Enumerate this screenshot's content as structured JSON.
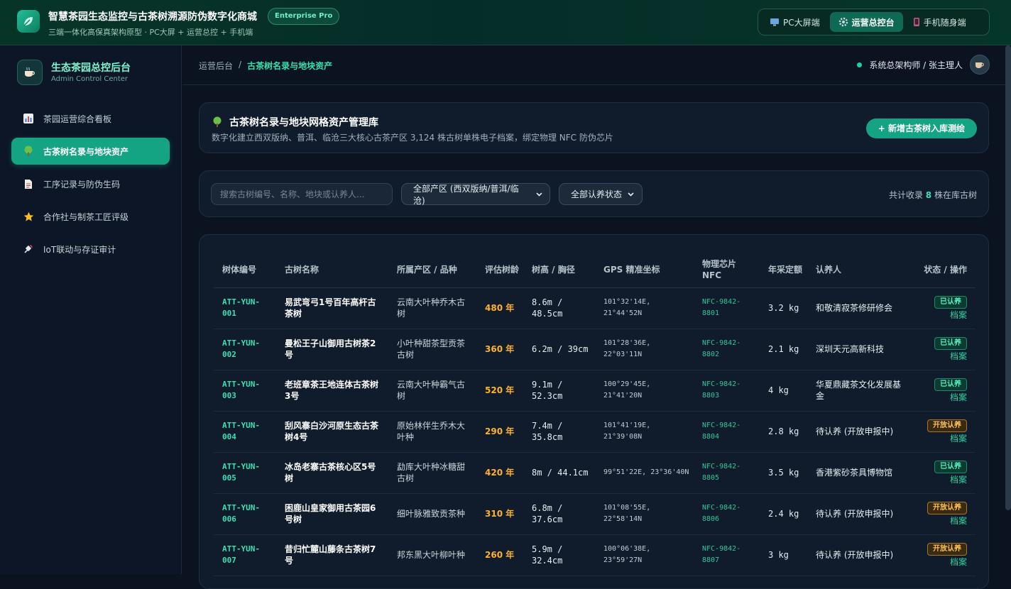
{
  "topbar": {
    "title": "智慧茶园生态监控与古茶树溯源防伪数字化商城",
    "edition": "Enterprise Pro",
    "subtitle": "三端一体化高保真架构原型 · PC大屏 + 运营总控 + 手机端",
    "views": [
      {
        "label": "PC大屏端",
        "icon": "monitor-icon",
        "active": false
      },
      {
        "label": "运营总控台",
        "icon": "gear-icon",
        "active": true
      },
      {
        "label": "手机随身端",
        "icon": "phone-icon",
        "active": false
      }
    ]
  },
  "sidebar": {
    "title": "生态茶园总控后台",
    "subtitle": "Admin Control Center",
    "items": [
      {
        "label": "茶园运营综合看板",
        "icon": "bar-chart-icon",
        "active": false
      },
      {
        "label": "古茶树名录与地块资产",
        "icon": "tree-icon",
        "active": true
      },
      {
        "label": "工序记录与防伪生码",
        "icon": "document-icon",
        "active": false
      },
      {
        "label": "合作社与制茶工匠评级",
        "icon": "star-icon",
        "active": false
      },
      {
        "label": "IoT联动与存证审计",
        "icon": "satellite-icon",
        "active": false
      }
    ]
  },
  "header": {
    "crumb_root": "运营后台",
    "crumb_sep": "/",
    "crumb_current": "古茶树名录与地块资产",
    "user": "系统总架构师 / 张主理人"
  },
  "hero": {
    "title": "古茶树名录与地块网格资产管理库",
    "desc": "数字化建立西双版纳、普洱、临沧三大核心古茶产区 3,124 株古树单株电子档案，绑定物理 NFC 防伪芯片",
    "action": "+ 新增古茶树入库测绘"
  },
  "filters": {
    "search_placeholder": "搜索古树编号、名称、地块或认养人...",
    "region": "全部产区 (西双版纳/普洱/临沧)",
    "status": "全部认养状态",
    "count_prefix": "共计收录",
    "count": "8",
    "count_suffix": "株在库古树"
  },
  "table": {
    "headers": [
      "树体编号",
      "古树名称",
      "所属产区 / 品种",
      "评估树龄",
      "树高 / 胸径",
      "GPS 精准坐标",
      "物理芯片 NFC",
      "年采定额",
      "认养人",
      "状态 / 操作"
    ],
    "link_label": "档案",
    "rows": [
      {
        "id": "ATT-YUN-001",
        "name": "易武弯弓1号百年高杆古茶树",
        "region": "云南大叶种乔木古树",
        "age": "480 年",
        "size": "8.6m / 48.5cm",
        "gps": "101°32'14E, 21°44'52N",
        "nfc": "NFC-9842-8801",
        "yield": "3.2 kg",
        "adopter": "和敬清寂茶修研修会",
        "status": "已认养",
        "kind": "ok"
      },
      {
        "id": "ATT-YUN-002",
        "name": "曼松王子山御用古树茶2号",
        "region": "小叶种甜茶型贡茶古树",
        "age": "360 年",
        "size": "6.2m / 39cm",
        "gps": "101°28'36E, 22°03'11N",
        "nfc": "NFC-9842-8802",
        "yield": "2.1 kg",
        "adopter": "深圳天元高新科技",
        "status": "已认养",
        "kind": "ok"
      },
      {
        "id": "ATT-YUN-003",
        "name": "老班章茶王地连体古茶树3号",
        "region": "云南大叶种霸气古树",
        "age": "520 年",
        "size": "9.1m / 52.3cm",
        "gps": "100°29'45E, 21°41'20N",
        "nfc": "NFC-9842-8803",
        "yield": "4 kg",
        "adopter": "华夏鼎藏茶文化发展基金",
        "status": "已认养",
        "kind": "ok"
      },
      {
        "id": "ATT-YUN-004",
        "name": "刮风寨白沙河原生态古茶树4号",
        "region": "原始林伴生乔木大叶种",
        "age": "290 年",
        "size": "7.4m / 35.8cm",
        "gps": "101°41'19E, 21°39'08N",
        "nfc": "NFC-9842-8804",
        "yield": "2.8 kg",
        "adopter": "待认养 (开放申报中)",
        "status": "开放认养",
        "kind": "open"
      },
      {
        "id": "ATT-YUN-005",
        "name": "冰岛老寨古茶核心区5号树",
        "region": "勐库大叶种冰糖甜古树",
        "age": "420 年",
        "size": "8m / 44.1cm",
        "gps": "99°51'22E, 23°36'40N",
        "nfc": "NFC-9842-8805",
        "yield": "3.5 kg",
        "adopter": "香港紫砂茶具博物馆",
        "status": "已认养",
        "kind": "ok"
      },
      {
        "id": "ATT-YUN-006",
        "name": "困鹿山皇家御用古茶园6号树",
        "region": "细叶脉雅致贡茶种",
        "age": "310 年",
        "size": "6.8m / 37.6cm",
        "gps": "101°08'55E, 22°58'14N",
        "nfc": "NFC-9842-8806",
        "yield": "2.4 kg",
        "adopter": "待认养 (开放申报中)",
        "status": "开放认养",
        "kind": "open"
      },
      {
        "id": "ATT-YUN-007",
        "name": "昔归忙麓山藤条古茶树7号",
        "region": "邦东黑大叶柳叶种",
        "age": "260 年",
        "size": "5.9m / 32.4cm",
        "gps": "100°06'38E, 23°59'27N",
        "nfc": "NFC-9842-8807",
        "yield": "3 kg",
        "adopter": "待认养 (开放申报中)",
        "status": "开放认养",
        "kind": "open"
      }
    ]
  }
}
